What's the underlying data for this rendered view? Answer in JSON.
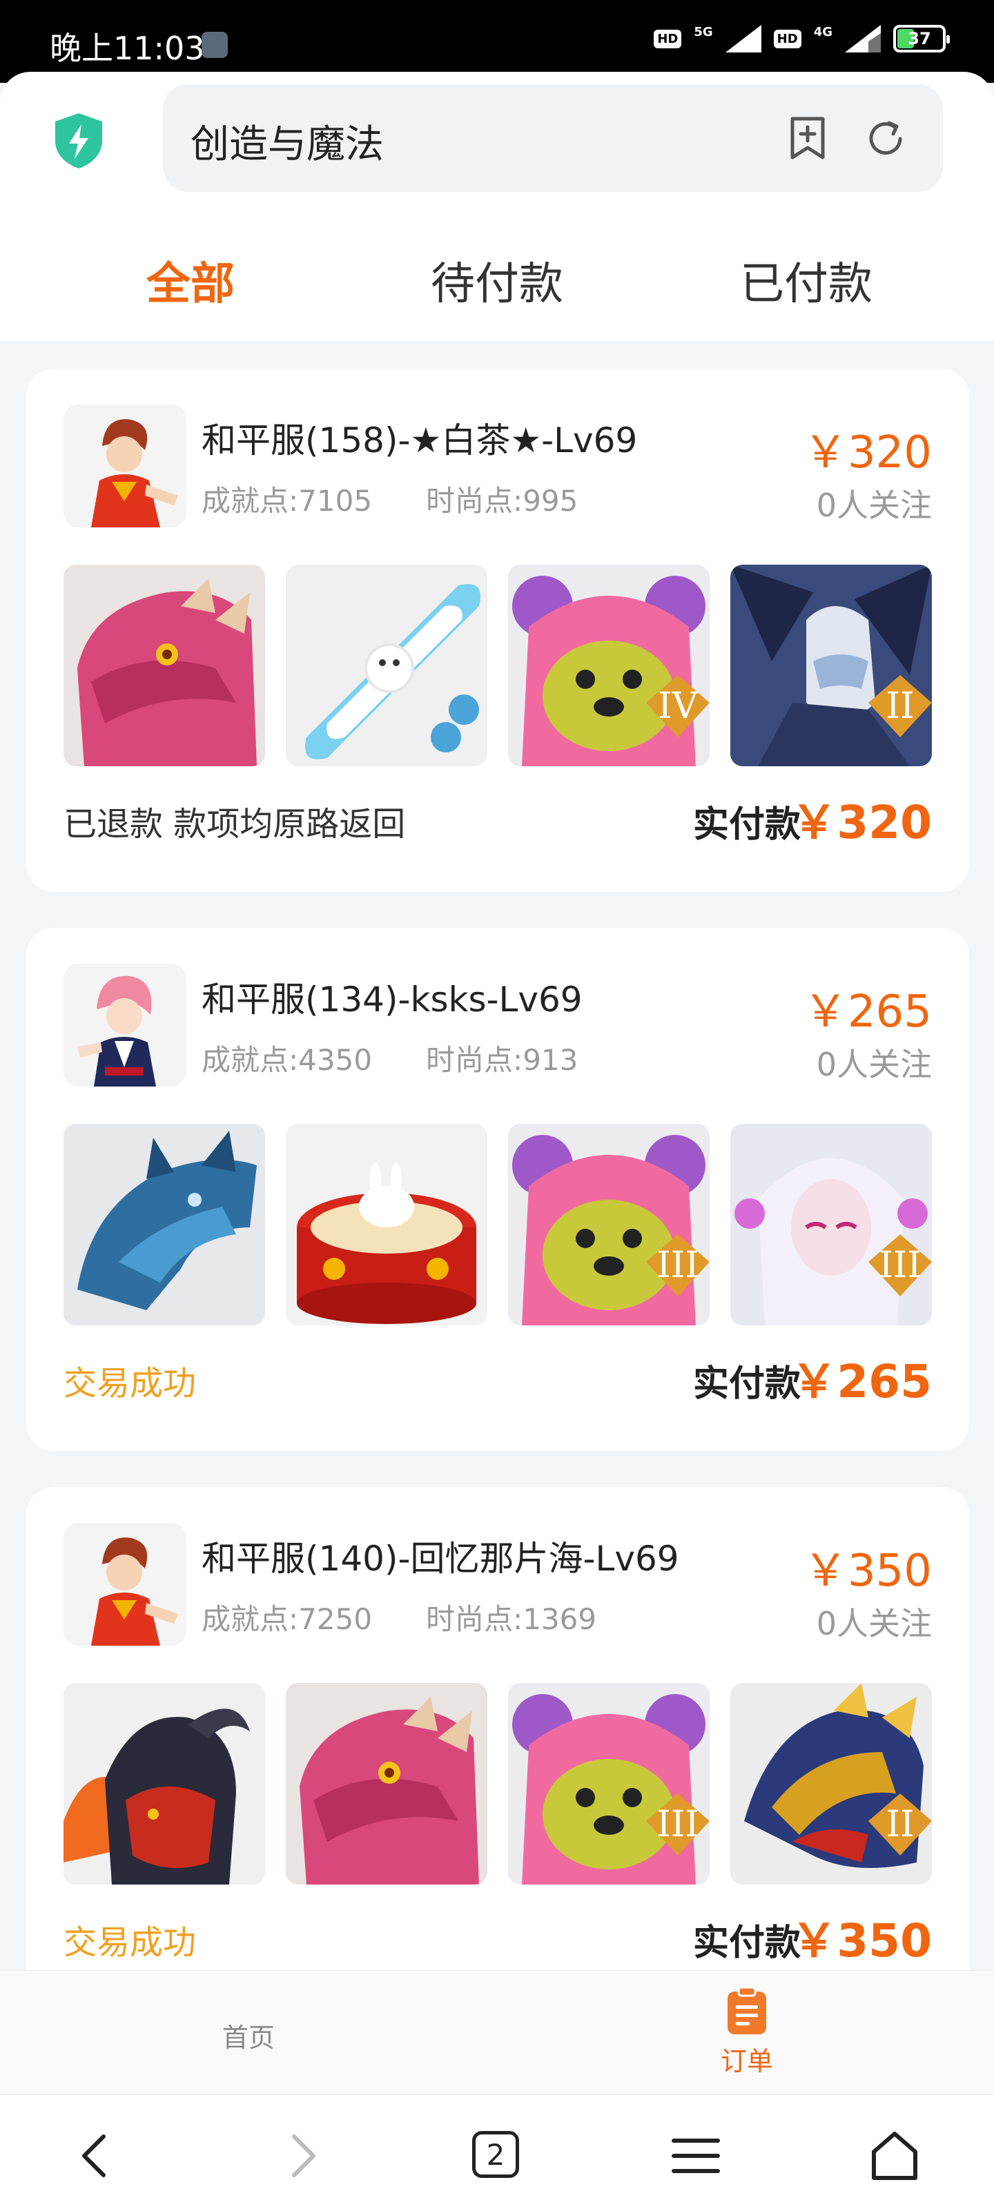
{
  "status_bar": {
    "time": "晚上11:03",
    "hd1": "HD",
    "net1": "5G",
    "hd2": "HD",
    "net2": "4G",
    "battery": "37"
  },
  "browser": {
    "address_text": "创造与魔法",
    "tabs_count": "2"
  },
  "tabs": [
    {
      "label": "全部",
      "active": true
    },
    {
      "label": "待付款",
      "active": false
    },
    {
      "label": "已付款",
      "active": false
    }
  ],
  "orders": [
    {
      "title": "和平服(158)-★白茶★-Lv69",
      "achievement": "成就点:7105",
      "fashion": "时尚点:995",
      "price": "￥320",
      "followers": "0人关注",
      "items": [
        "red-dragon-head",
        "hamster-skateboard",
        "pink-bear-hood-iv",
        "ice-demon-ii"
      ],
      "status": "已退款 款项均原路返回",
      "paid_label": "实付款",
      "paid_amount": "￥320"
    },
    {
      "title": "和平服(134)-ksks-Lv69",
      "achievement": "成就点:4350",
      "fashion": "时尚点:913",
      "price": "￥265",
      "followers": "0人关注",
      "items": [
        "blue-ice-dragon",
        "red-drum-rabbit",
        "pink-bear-hood-iii",
        "white-hair-girl-iii"
      ],
      "status": "交易成功",
      "paid_label": "实付款",
      "paid_amount": "￥265"
    },
    {
      "title": "和平服(140)-回忆那片海-Lv69",
      "achievement": "成就点:7250",
      "fashion": "时尚点:1369",
      "price": "￥350",
      "followers": "0人关注",
      "items": [
        "black-ram-beast",
        "red-dragon-head",
        "pink-bear-hood-iii",
        "gold-dragon-ii"
      ],
      "status": "交易成功",
      "paid_label": "实付款",
      "paid_amount": "￥350"
    }
  ],
  "bottom_nav": {
    "home_label": "首页",
    "orders_label": "订单"
  },
  "colors": {
    "accent": "#f0650f",
    "success": "#f0a020"
  }
}
